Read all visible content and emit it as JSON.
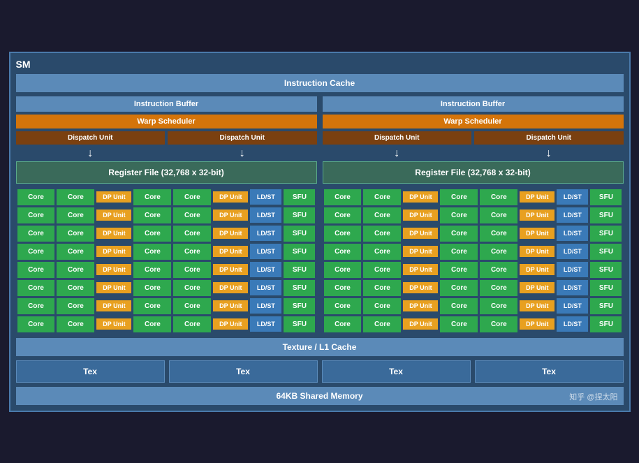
{
  "sm": {
    "label": "SM",
    "instruction_cache": "Instruction Cache",
    "left_half": {
      "instruction_buffer": "Instruction Buffer",
      "warp_scheduler": "Warp Scheduler",
      "dispatch_unit1": "Dispatch Unit",
      "dispatch_unit2": "Dispatch Unit",
      "register_file": "Register File (32,768 x 32-bit)"
    },
    "right_half": {
      "instruction_buffer": "Instruction Buffer",
      "warp_scheduler": "Warp Scheduler",
      "dispatch_unit1": "Dispatch Unit",
      "dispatch_unit2": "Dispatch Unit",
      "register_file": "Register File (32,768 x 32-bit)"
    },
    "core_label": "Core",
    "dp_unit_label": "DP\nUnit",
    "ld_st_label": "LD/ST",
    "sfu_label": "SFU",
    "num_rows": 8,
    "texture_cache": "Texture / L1 Cache",
    "tex_label": "Tex",
    "shared_memory": "64KB Shared Memory",
    "watermark": "知乎 @捏太阳"
  }
}
